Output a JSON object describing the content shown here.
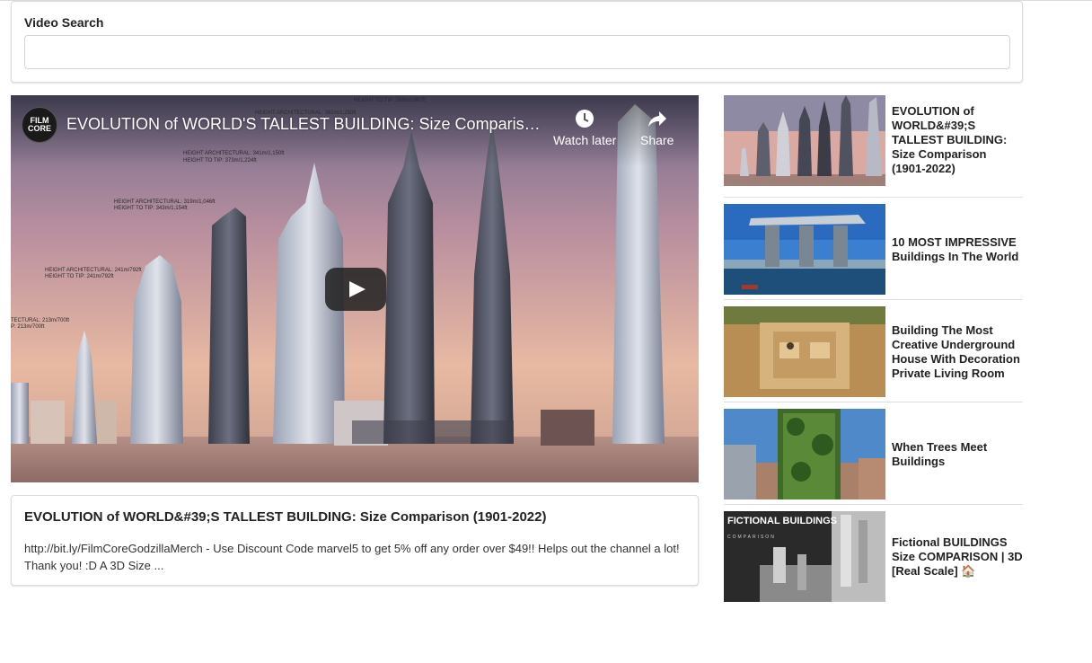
{
  "search": {
    "label": "Video Search",
    "value": "",
    "placeholder": ""
  },
  "player": {
    "title": "EVOLUTION of WORLD'S TALLEST BUILDING: Size Comparison (1901-2022)",
    "channel_avatar": "FILM CORE",
    "watch_later_label": "Watch later",
    "share_label": "Share",
    "annotations": [
      "HEIGHT TO TIP: 508m/1667ft",
      "HEIGHT ARCHITECTURAL: 381m/1,250ft",
      "HEIGHT ARCHITECTURAL: 341m/1,150ft",
      "HEIGHT TO TIP: 373m/1,224ft",
      "HEIGHT ARCHITECTURAL: 319m/1,046ft",
      "HEIGHT TO TIP: 343m/1,154ft",
      "HEIGHT ARCHITECTURAL: 241m/792ft",
      "HEIGHT TO TIP: 241m/792ft",
      "TECTURAL: 213m/700ft",
      "P: 213m/700ft"
    ]
  },
  "selected": {
    "title": "EVOLUTION of WORLD&#39;S TALLEST BUILDING: Size Comparison (1901-2022)",
    "description": "http://bit.ly/FilmCoreGodzillaMerch - Use Discount Code marvel5 to get 5% off any order over $49!! Helps out the channel a lot! Thank you! :D A 3D Size ..."
  },
  "videos": [
    {
      "title": "EVOLUTION of WORLD&#39;S TALLEST BUILDING: Size Comparison (1901-2022)"
    },
    {
      "title": "10 MOST IMPRESSIVE Buildings In The World"
    },
    {
      "title": "Building The Most Creative Underground House With Decoration Private Living Room"
    },
    {
      "title": "When Trees Meet Buildings"
    },
    {
      "title": "Fictional BUILDINGS Size COMPARISON | 3D [Real Scale] 🏠",
      "thumb_text": "FICTIONAL BUILDINGS",
      "thumb_subtext": "COMPARISON"
    }
  ]
}
